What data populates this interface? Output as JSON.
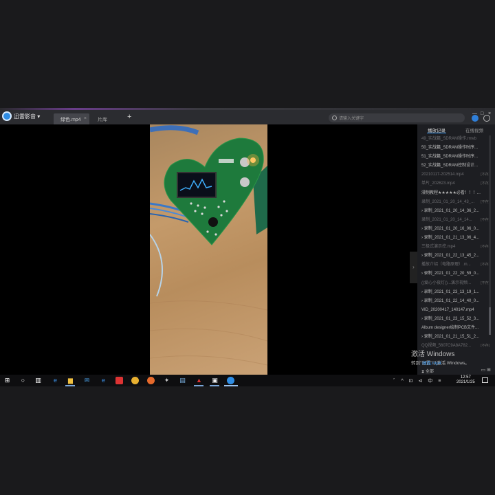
{
  "app": {
    "name": "迅雷影音",
    "name_suffix": "▾"
  },
  "tabs": [
    {
      "label": "绿色.mp4",
      "close": "×"
    },
    {
      "label": "片库"
    }
  ],
  "tab_add": "+",
  "search": {
    "placeholder": "请输入关键字"
  },
  "window_controls": [
    "—",
    "□",
    "×"
  ],
  "playlist": {
    "tabs": [
      "播放记录",
      "在线视频"
    ],
    "items": [
      {
        "label": "49_实战篇_SDRAM操作.rmvb",
        "dim": true,
        "tag": ""
      },
      {
        "label": "50_实战篇_SDRAM操作时序...",
        "dim": false,
        "tag": ""
      },
      {
        "label": "51_实战篇_SDRAM操作时序...",
        "dim": false,
        "tag": ""
      },
      {
        "label": "52_实战篇_SDRAM控制设计...",
        "dim": false,
        "tag": ""
      },
      {
        "label": "20210117-202514.mp4",
        "dim": true,
        "tag": "[不存]"
      },
      {
        "label": "单片_202623.mp4",
        "dim": true,
        "tag": "[不存]"
      },
      {
        "label": "浸制教程★★★★★必看！！！...",
        "dim": false,
        "tag": ""
      },
      {
        "label": "录制_2021_01_20_14_43_...",
        "dim": true,
        "tag": "[不存]"
      },
      {
        "label": "› 录制_2021_01_20_14_36_2...",
        "dim": false,
        "tag": ""
      },
      {
        "label": "录制_2021_01_20_14_14...",
        "dim": true,
        "tag": "[不存]"
      },
      {
        "label": "› 录制_2021_01_20_16_06_0...",
        "dim": false,
        "tag": ""
      },
      {
        "label": "› 录制_2021_01_21_13_06_4...",
        "dim": false,
        "tag": ""
      },
      {
        "label": "三极式演示控.mp4",
        "dim": true,
        "tag": "[不存]"
      },
      {
        "label": "› 录制_2021_01_22_13_45_2...",
        "dim": false,
        "tag": ""
      },
      {
        "label": "播放介绍（电路原理）.m...",
        "dim": true,
        "tag": "[不存]"
      },
      {
        "label": "› 录制_2021_01_22_20_59_0...",
        "dim": false,
        "tag": ""
      },
      {
        "label": "((爱心小夜灯))...演示视频...",
        "dim": true,
        "tag": "[不存]"
      },
      {
        "label": "› 录制_2021_01_23_13_19_1...",
        "dim": false,
        "tag": ""
      },
      {
        "label": "› 录制_2021_01_22_14_40_0...",
        "dim": false,
        "tag": ""
      },
      {
        "label": "VID_20200417_140147.mp4",
        "dim": false,
        "tag": ""
      },
      {
        "label": "› 录制_2021_01_23_15_52_3...",
        "dim": false,
        "tag": ""
      },
      {
        "label": "Album designer绘制PCB文件...",
        "dim": false,
        "tag": ""
      },
      {
        "label": "› 录制_2021_01_21_15_51_2...",
        "dim": false,
        "tag": ""
      },
      {
        "label": "QQ视频_5607C9A8A782...",
        "dim": true,
        "tag": "[不存]"
      }
    ],
    "now_playing": "绿色.mp4",
    "bottom_label": "全部",
    "bottom_icons": "▭ ⊞"
  },
  "watermark": {
    "line1": "激活 Windows",
    "line2": "转到\"设置\"以激活 Windows。"
  },
  "taskbar": {
    "tray": "ﾞ ^ ⊡ ⊲ 中 ≡",
    "time": "12:57",
    "date": "2021/1/25"
  },
  "colors": {
    "accent": "#2f8de4",
    "titlebar": "#2b2c30",
    "playlist_bg": "#1d1e22"
  }
}
